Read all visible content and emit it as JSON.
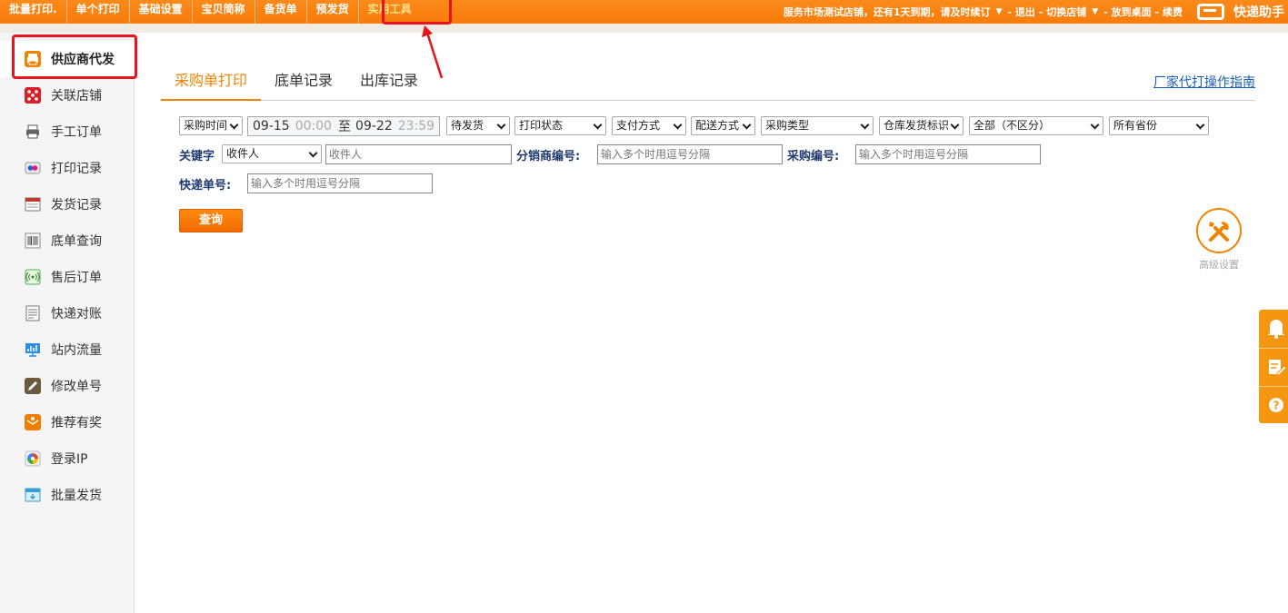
{
  "topbar": {
    "nav": [
      "批量打印.",
      "单个打印",
      "基础设置",
      "宝贝简称",
      "备货单",
      "预发货",
      "实用工具"
    ],
    "notice": "服务市场测试店铺，还有1天到期，请及时续订",
    "logout": "- 退出 -",
    "switch_store": "切换店铺",
    "desktop": "- 放到桌面 -",
    "renew": "续费",
    "brand": "快递助手"
  },
  "sidebar": {
    "items": [
      {
        "label": "供应商代发",
        "icon": "printer-icon"
      },
      {
        "label": "关联店铺",
        "icon": "dice-icon"
      },
      {
        "label": "手工订单",
        "icon": "printer-gray-icon"
      },
      {
        "label": "打印记录",
        "icon": "dots-icon"
      },
      {
        "label": "发货记录",
        "icon": "calendar-icon"
      },
      {
        "label": "底单查询",
        "icon": "barcode-icon"
      },
      {
        "label": "售后订单",
        "icon": "signal-icon"
      },
      {
        "label": "快递对账",
        "icon": "document-icon"
      },
      {
        "label": "站内流量",
        "icon": "monitor-icon"
      },
      {
        "label": "修改单号",
        "icon": "edit-icon"
      },
      {
        "label": "推荐有奖",
        "icon": "gift-icon"
      },
      {
        "label": "登录IP",
        "icon": "pinwheel-icon"
      },
      {
        "label": "批量发货",
        "icon": "box-icon"
      }
    ]
  },
  "tabs": [
    "采购单打印",
    "底单记录",
    "出库记录"
  ],
  "guide_link": "厂家代打操作指南",
  "filters": {
    "time_type": "采购时间",
    "date_from": "09-15",
    "time_from": "00:00",
    "date_sep": "至",
    "date_to": "09-22",
    "time_to": "23:59",
    "status": "待发货",
    "print_status": "打印状态",
    "pay_method": "支付方式",
    "ship_method": "配送方式",
    "purchase_type": "采购类型",
    "warehouse_flag": "仓库发货标识",
    "scope": "全部（不区分）",
    "province": "所有省份",
    "keyword_label": "关键字",
    "keyword_type": "收件人",
    "keyword_placeholder": "收件人",
    "distributor_label": "分销商编号:",
    "distributor_placeholder": "输入多个时用逗号分隔",
    "purchase_no_label": "采购编号:",
    "purchase_no_placeholder": "输入多个时用逗号分隔",
    "express_no_label": "快递单号:",
    "express_no_placeholder": "输入多个时用逗号分隔"
  },
  "query_button": "查询",
  "advanced_settings": "高级设置",
  "float_tools": [
    "bell-icon",
    "edit-note-icon",
    "help-icon"
  ],
  "colors": {
    "accent": "#f08300",
    "topbar": "#f77c0b",
    "annotation": "#e8141b",
    "link": "#1a5fb4"
  }
}
